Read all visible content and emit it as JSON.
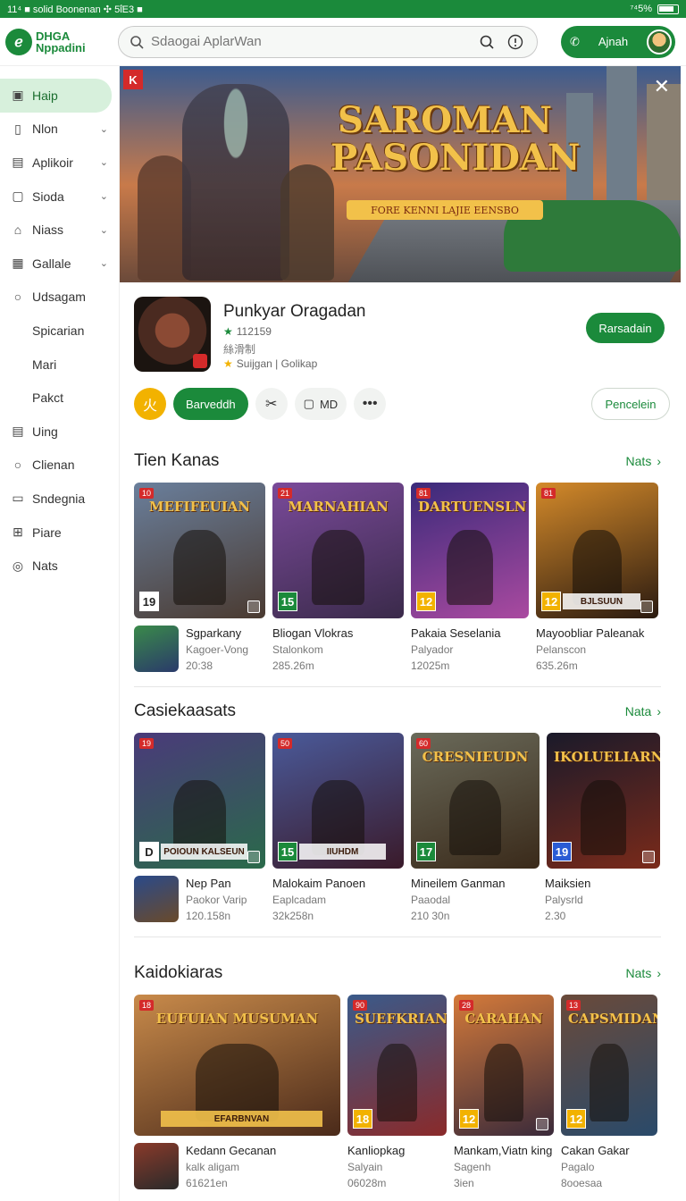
{
  "statusbar": {
    "left": "11⁴ ■ solid Boonenan ✣ 5ΐE3 ■",
    "right": "⁷⁴5%"
  },
  "header": {
    "logo_line1": "DHGA",
    "logo_line2": "Nppadini",
    "search_placeholder": "Sdaogai AplarWan",
    "signin_label": "Ajnah"
  },
  "sidebar": {
    "items": [
      {
        "label": "Haip",
        "icon": "home-icon"
      },
      {
        "label": "Nlon",
        "icon": "book-icon"
      },
      {
        "label": "Aplikoir",
        "icon": "app-icon"
      },
      {
        "label": "Sioda",
        "icon": "square-icon"
      },
      {
        "label": "Niass",
        "icon": "house-icon"
      },
      {
        "label": "Gallale",
        "icon": "gallery-icon"
      },
      {
        "label": "Udsagam",
        "icon": "search-icon"
      },
      {
        "label": "Spicarian",
        "icon": ""
      },
      {
        "label": "Mari",
        "icon": ""
      },
      {
        "label": "Pakct",
        "icon": ""
      },
      {
        "label": "Uing",
        "icon": "file-icon"
      },
      {
        "label": "Clienan",
        "icon": "search-icon"
      },
      {
        "label": "Sndegnia",
        "icon": "card-icon"
      },
      {
        "label": "Piare",
        "icon": "grid-icon"
      },
      {
        "label": "Nats",
        "icon": "circle-icon"
      }
    ]
  },
  "hero": {
    "badge": "K",
    "title_line1": "SAROMAN",
    "title_line2": "PASONIDAN",
    "tagline": "FORE KENNI LAJIE EENSBO"
  },
  "app": {
    "title": "Punkyar Oragadan",
    "rating": "112159",
    "meta": "絲滑制",
    "developer": "Suijgan | Golikap",
    "install_label": "Rarsadain"
  },
  "actions": {
    "yellow_glyph": "火",
    "green_label": "Barveddh",
    "pill_label": "MD",
    "outline_label": "Pencelein"
  },
  "sections": [
    {
      "title": "Tien Kanas",
      "more": "Nats",
      "cards": [
        {
          "age": "10",
          "title": "MEFIFEUIAN",
          "rating": "19",
          "band": "",
          "c1": "#6a7f9c",
          "c2": "#4a3a30"
        },
        {
          "age": "21",
          "title": "MARNAHIAN",
          "rating": "15",
          "band": "",
          "c1": "#7a4a9a",
          "c2": "#3a2a4a"
        },
        {
          "age": "81",
          "title": "DARTUENSLN",
          "rating": "12",
          "band": "",
          "c1": "#3a2a7a",
          "c2": "#aa4aa0"
        },
        {
          "age": "81",
          "title": "",
          "rating": "12",
          "band": "BJLSUUN",
          "c1": "#d48a2a",
          "c2": "#2a1a10"
        }
      ],
      "infos": [
        {
          "name": "Sgparkany",
          "sub": "Kagoer-Vong",
          "size": "20:38"
        },
        {
          "name": "Bliogan Vlokras",
          "sub": "Stalonkom",
          "size": "285.26m"
        },
        {
          "name": "Pakaia Seselania",
          "sub": "Palyador",
          "size": "12025m"
        },
        {
          "name": "Mayoobliar Paleanak",
          "sub": "Pelanscon",
          "size": "635.26m"
        }
      ]
    },
    {
      "title": "Casiekaasats",
      "more": "Nata",
      "cards": [
        {
          "age": "19",
          "title": "",
          "rating": "D",
          "band": "POIOUN KALSEUN",
          "c1": "#4a3a7a",
          "c2": "#2a6a4a"
        },
        {
          "age": "50",
          "title": "",
          "rating": "15",
          "band": "IIUHDM",
          "c1": "#4a5a9a",
          "c2": "#3a1a2a"
        },
        {
          "age": "60",
          "title": "CRESNIEUDN",
          "rating": "17",
          "band": "",
          "c1": "#6a6a5a",
          "c2": "#3a2a1a"
        },
        {
          "age": "",
          "title": "IKOLUELIARN",
          "rating": "19",
          "band": "",
          "c1": "#1a1a2a",
          "c2": "#7a2a1a"
        }
      ],
      "infos": [
        {
          "name": "Nep Pan",
          "sub": "Paokor Varip",
          "size": "120.158n"
        },
        {
          "name": "Malokaim Panoen",
          "sub": "Eaplcadam",
          "size": "32k258n"
        },
        {
          "name": "Mineilem Ganman",
          "sub": "Paaodal",
          "size": "210 30n"
        },
        {
          "name": "Maiksien",
          "sub": "Palysrld",
          "size": "2.30"
        }
      ]
    },
    {
      "title": "Kaidokiaras",
      "more": "Nats",
      "cards": [
        {
          "age": "18",
          "title": "EUFUIAN  MUSUMAN",
          "rating": "",
          "band": "EFARBNVAN",
          "c1": "#c88a4a",
          "c2": "#4a2a1a"
        },
        {
          "age": "90",
          "title": "SUEFKRIAN",
          "rating": "18",
          "band": "",
          "c1": "#3a5a8a",
          "c2": "#8a2a2a"
        },
        {
          "age": "28",
          "title": "CARAHAN",
          "rating": "12",
          "band": "",
          "c1": "#d47a3a",
          "c2": "#3a2a3a"
        },
        {
          "age": "13",
          "title": "CAPSMIDAN",
          "rating": "12",
          "band": "",
          "c1": "#6a4a3a",
          "c2": "#2a4a6a"
        }
      ],
      "infos": [
        {
          "name": "Kedann Gecanan",
          "sub": "kalk aligam",
          "size": "61621en"
        },
        {
          "name": "Kanliopkag",
          "sub": "Salyain",
          "size": "06028m"
        },
        {
          "name": "Mankam,Viatn king",
          "sub": "Sagenh",
          "size": "3ien"
        },
        {
          "name": "Cakan Gakar",
          "sub": "Pagalo",
          "size": "8ooesaa"
        }
      ]
    }
  ],
  "colors": {
    "brand": "#1b8a3b",
    "accent": "#f2b200"
  }
}
